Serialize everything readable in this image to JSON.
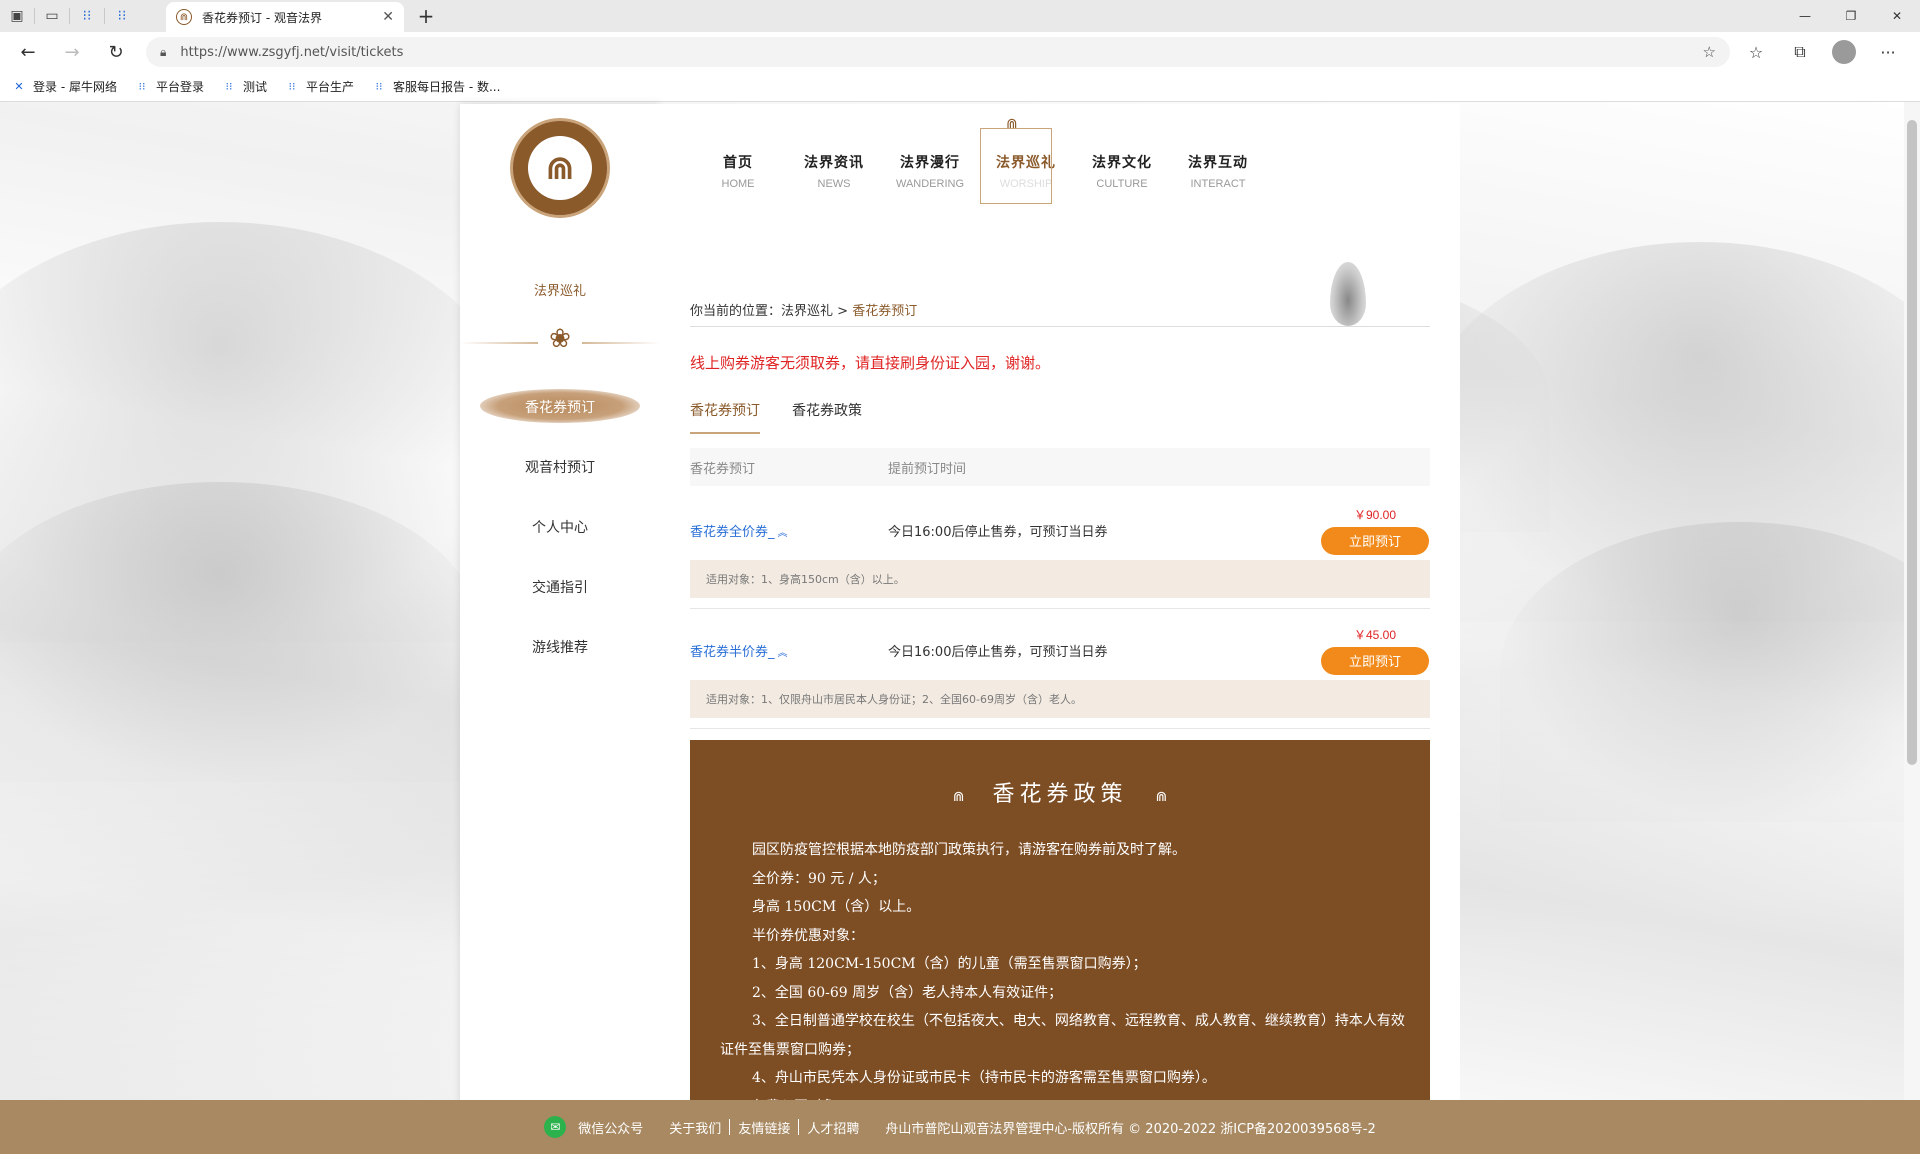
{
  "browser": {
    "tab_title": "香花券预订 - 观音法界",
    "url": "https://www.zsgyfj.net/visit/tickets",
    "bookmarks": [
      "登录 - 犀牛网络",
      "平台登录",
      "测试",
      "平台生产",
      "客服每日报告 - 数..."
    ]
  },
  "sidebar": {
    "title": "法界巡礼",
    "items": [
      "香花券预订",
      "观音村预订",
      "个人中心",
      "交通指引",
      "游线推荐"
    ]
  },
  "topnav": [
    {
      "cn": "首页",
      "en": "HOME"
    },
    {
      "cn": "法界资讯",
      "en": "NEWS"
    },
    {
      "cn": "法界漫行",
      "en": "WANDERING"
    },
    {
      "cn": "法界巡礼",
      "en": "WORSHIP"
    },
    {
      "cn": "法界文化",
      "en": "CULTURE"
    },
    {
      "cn": "法界互动",
      "en": "INTERACT"
    }
  ],
  "breadcrumb": {
    "prefix": "你当前的位置：",
    "parent": "法界巡礼",
    "sep": " > ",
    "current": "香花券预订"
  },
  "notice": "线上购券游客无须取券，请直接刷身份证入园，谢谢。",
  "tabs": [
    "香花券预订",
    "香花券政策"
  ],
  "table": {
    "headers": [
      "香花券预订",
      "提前预订时间"
    ],
    "rows": [
      {
        "name": "香花券全价券_",
        "desc": "今日16:00后停止售券，可预订当日券",
        "price": "￥90.00",
        "button": "立即预订",
        "note": "适用对象：1、身高150cm（含）以上。"
      },
      {
        "name": "香花券半价券_",
        "desc": "今日16:00后停止售券，可预订当日券",
        "price": "￥45.00",
        "button": "立即预订",
        "note": "适用对象：1、仅限舟山市居民本人身份证；2、全国60-69周岁（含）老人。"
      }
    ]
  },
  "policy": {
    "title": "香花券政策",
    "lines": [
      "园区防疫管控根据本地防疫部门政策执行，请游客在购券前及时了解。",
      "全价券：90 元 / 人；",
      "身高 150CM（含）以上。",
      "半价券优惠对象：",
      "1、身高 120CM-150CM（含）的儿童（需至售票窗口购券）；",
      "2、全国 60-69 周岁（含）老人持本人有效证件；",
      "3、全日制普通学校在校生（不包括夜大、电大、网络教育、远程教育、成人教育、继续教育）持本人有效证件至售票窗口购券；",
      "4、舟山市民凭本人身份证或市民卡（持市民卡的游客需至售票窗口购券）。",
      "免费入园对象："
    ]
  },
  "footer": {
    "wechat": "微信公众号",
    "links": [
      "关于我们",
      "友情链接",
      "人才招聘"
    ],
    "copyright": "舟山市普陀山观音法界管理中心-版权所有 © 2020-2022 浙ICP备2020039568号-2"
  }
}
